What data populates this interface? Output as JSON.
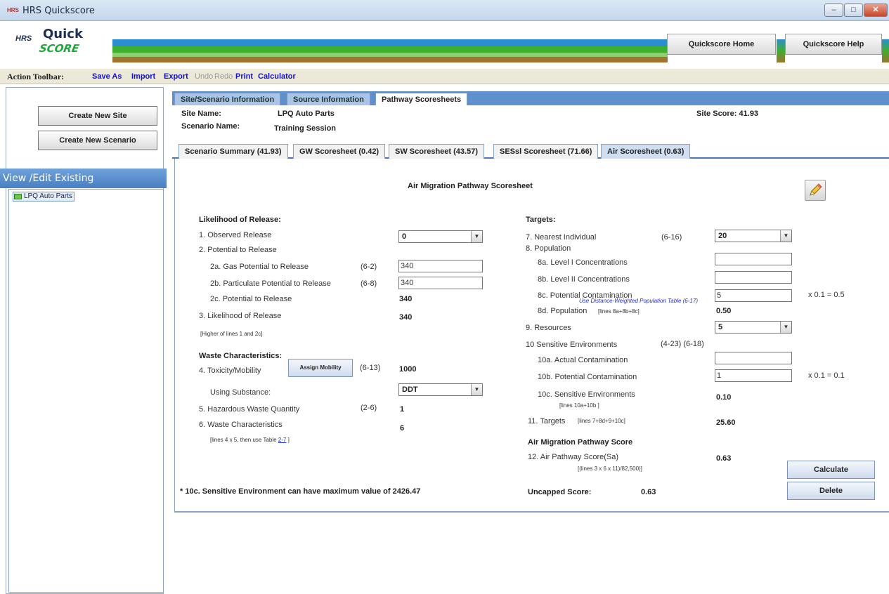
{
  "window": {
    "title": "HRS Quickscore",
    "icon_text": "HRS",
    "minimize": "–",
    "maximize": "□",
    "close": "✕"
  },
  "banner": {
    "logo_hrs": "HRS",
    "logo_quick": "Quick",
    "logo_score": "SCORE",
    "home_button": "Quickscore Home",
    "help_button": "Quickscore Help"
  },
  "toolbar": {
    "label": "Action Toolbar:",
    "items": [
      "Save As",
      "Import",
      "Export",
      "Undo",
      "Redo",
      "Print",
      "Calculator"
    ]
  },
  "sidebar": {
    "create_site": "Create New Site",
    "create_scenario": "Create New Scenario",
    "view_edit": "View /Edit Existing",
    "tree_item": "LPQ Auto Parts"
  },
  "outer_tabs": [
    "Site/Scenario Information",
    "Source Information",
    "Pathway Scoresheets"
  ],
  "site": {
    "name_label": "Site Name:",
    "name": "LPQ Auto Parts",
    "scenario_label": "Scenario Name:",
    "scenario": "Training Session",
    "score": "Site Score: 41.93"
  },
  "inner_tabs": [
    "Scenario Summary (41.93)",
    "GW Scoresheet (0.42)",
    "SW Scoresheet (43.57)",
    "SESsl Scoresheet (71.66)",
    "Air Scoresheet (0.63)"
  ],
  "sheet": {
    "title": "Air Migration Pathway Scoresheet",
    "left": {
      "likelihood_header": "Likelihood of Release:",
      "l1": "1. Observed Release",
      "l1_value": "0",
      "l2": "2. Potential to Release",
      "l2a": "2a. Gas Potential to Release",
      "l2a_ref": "(6-2)",
      "l2a_value": "340",
      "l2b": "2b. Particulate Potential to Release",
      "l2b_ref": "(6-8)",
      "l2b_value": "340",
      "l2c": "2c. Potential to Release",
      "l2c_value": "340",
      "l3": "3. Likelihood of Release",
      "l3_value": "340",
      "l3_note": "[Higher of lines 1 and 2c]",
      "waste_header": "Waste Characteristics:",
      "l4": "4. Toxicity/Mobility",
      "assign_mobility": "Assign Mobility",
      "l4_ref": "(6-13)",
      "l4_value": "1000",
      "substance_label": "Using Substance:",
      "substance_value": "DDT",
      "l5": "5. Hazardous Waste Quantity",
      "l5_ref": "(2-6)",
      "l5_value": "1",
      "l6": "6. Waste Characteristics",
      "l6_value": "6",
      "l6_note": "[lines 4 x 5, then use Table ",
      "l6_link": "2-7",
      "l6_note_end": " ]",
      "footnote": "* 10c. Sensitive Environment can have maximum value of 2426.47"
    },
    "right": {
      "targets_header": "Targets:",
      "l7": "7. Nearest Individual",
      "l7_ref": "(6-16)",
      "l7_value": "20",
      "l8": "8. Population",
      "l8a": "8a. Level I Concentrations",
      "l8a_value": "",
      "l8b": "8b. Level II Concentrations",
      "l8b_value": "",
      "l8c": "8c. Potential Contamination",
      "l8c_value": "5",
      "l8c_note": "Use Distance-Weighted Population Table (6-17)",
      "l8c_mult": "x 0.1 = 0.5",
      "l8d": "8d. Population",
      "l8d_note": "[lines 8a+8b+8c]",
      "l8d_value": "0.50",
      "l9": "9. Resources",
      "l9_value": "5",
      "l10": "10 Sensitive Environments",
      "l10_ref": "(4-23) (6-18)",
      "l10a": "10a. Actual Contamination",
      "l10a_value": "",
      "l10b": "10b. Potential Contamination",
      "l10b_value": "1",
      "l10b_mult": "x 0.1 = 0.1",
      "l10c": "10c. Sensitive Environments",
      "l10c_note": "[lines 10a+10b ]",
      "l10c_value": "0.10",
      "l11": "11. Targets",
      "l11_note": "[lines 7+8d+9+10c]",
      "l11_value": "25.60",
      "score_header": "Air Migration Pathway Score",
      "l12": "12. Air Pathway Score(Sa)",
      "l12_note": "[(lines 3 x 6 x 11)/82,500)]",
      "l12_value": "0.63",
      "uncapped_label": "Uncapped Score:",
      "uncapped_value": "0.63",
      "calculate": "Calculate",
      "delete": "Delete"
    }
  }
}
